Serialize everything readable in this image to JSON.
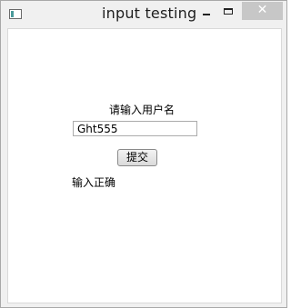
{
  "window": {
    "title": "input testing",
    "close_glyph": "✕",
    "app_icon": "window-app-icon"
  },
  "form": {
    "prompt_label": "请输入用户名",
    "username_value": "Ght555",
    "submit_label": "提交",
    "result_text": "输入正确"
  }
}
